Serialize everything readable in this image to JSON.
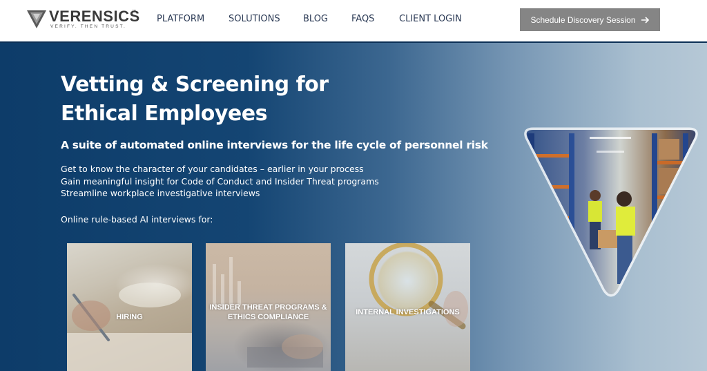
{
  "header": {
    "logo": {
      "name": "VERENSICS",
      "tm": "™",
      "tagline": "VERIFY. THEN TRUST."
    },
    "nav": [
      {
        "label": "PLATFORM"
      },
      {
        "label": "SOLUTIONS"
      },
      {
        "label": "BLOG"
      },
      {
        "label": "FAQS"
      },
      {
        "label": "CLIENT LOGIN"
      }
    ],
    "cta_label": "Schedule Discovery Session",
    "cta_icon": "arrow-right-icon"
  },
  "hero": {
    "title": "Vetting & Screening for Ethical Employees",
    "subtitle": "A suite of automated online interviews for the life cycle of personnel risk",
    "lines": [
      "Get to know the character of your candidates – earlier in your process",
      "Gain meaningful insight for Code of Conduct and Insider Threat programs",
      "Streamline workplace investigative interviews"
    ],
    "intro": "Online rule-based AI interviews for:",
    "cards": [
      {
        "label": "HIRING"
      },
      {
        "label": "INSIDER THREAT PROGRAMS & ETHICS COMPLIANCE"
      },
      {
        "label": "INTERNAL INVESTIGATIONS"
      }
    ]
  },
  "colors": {
    "nav_text": "#2b3a55",
    "cta_bg": "#858585",
    "hero_dark": "#0d3c69",
    "hero_light": "#b6c8d6"
  }
}
